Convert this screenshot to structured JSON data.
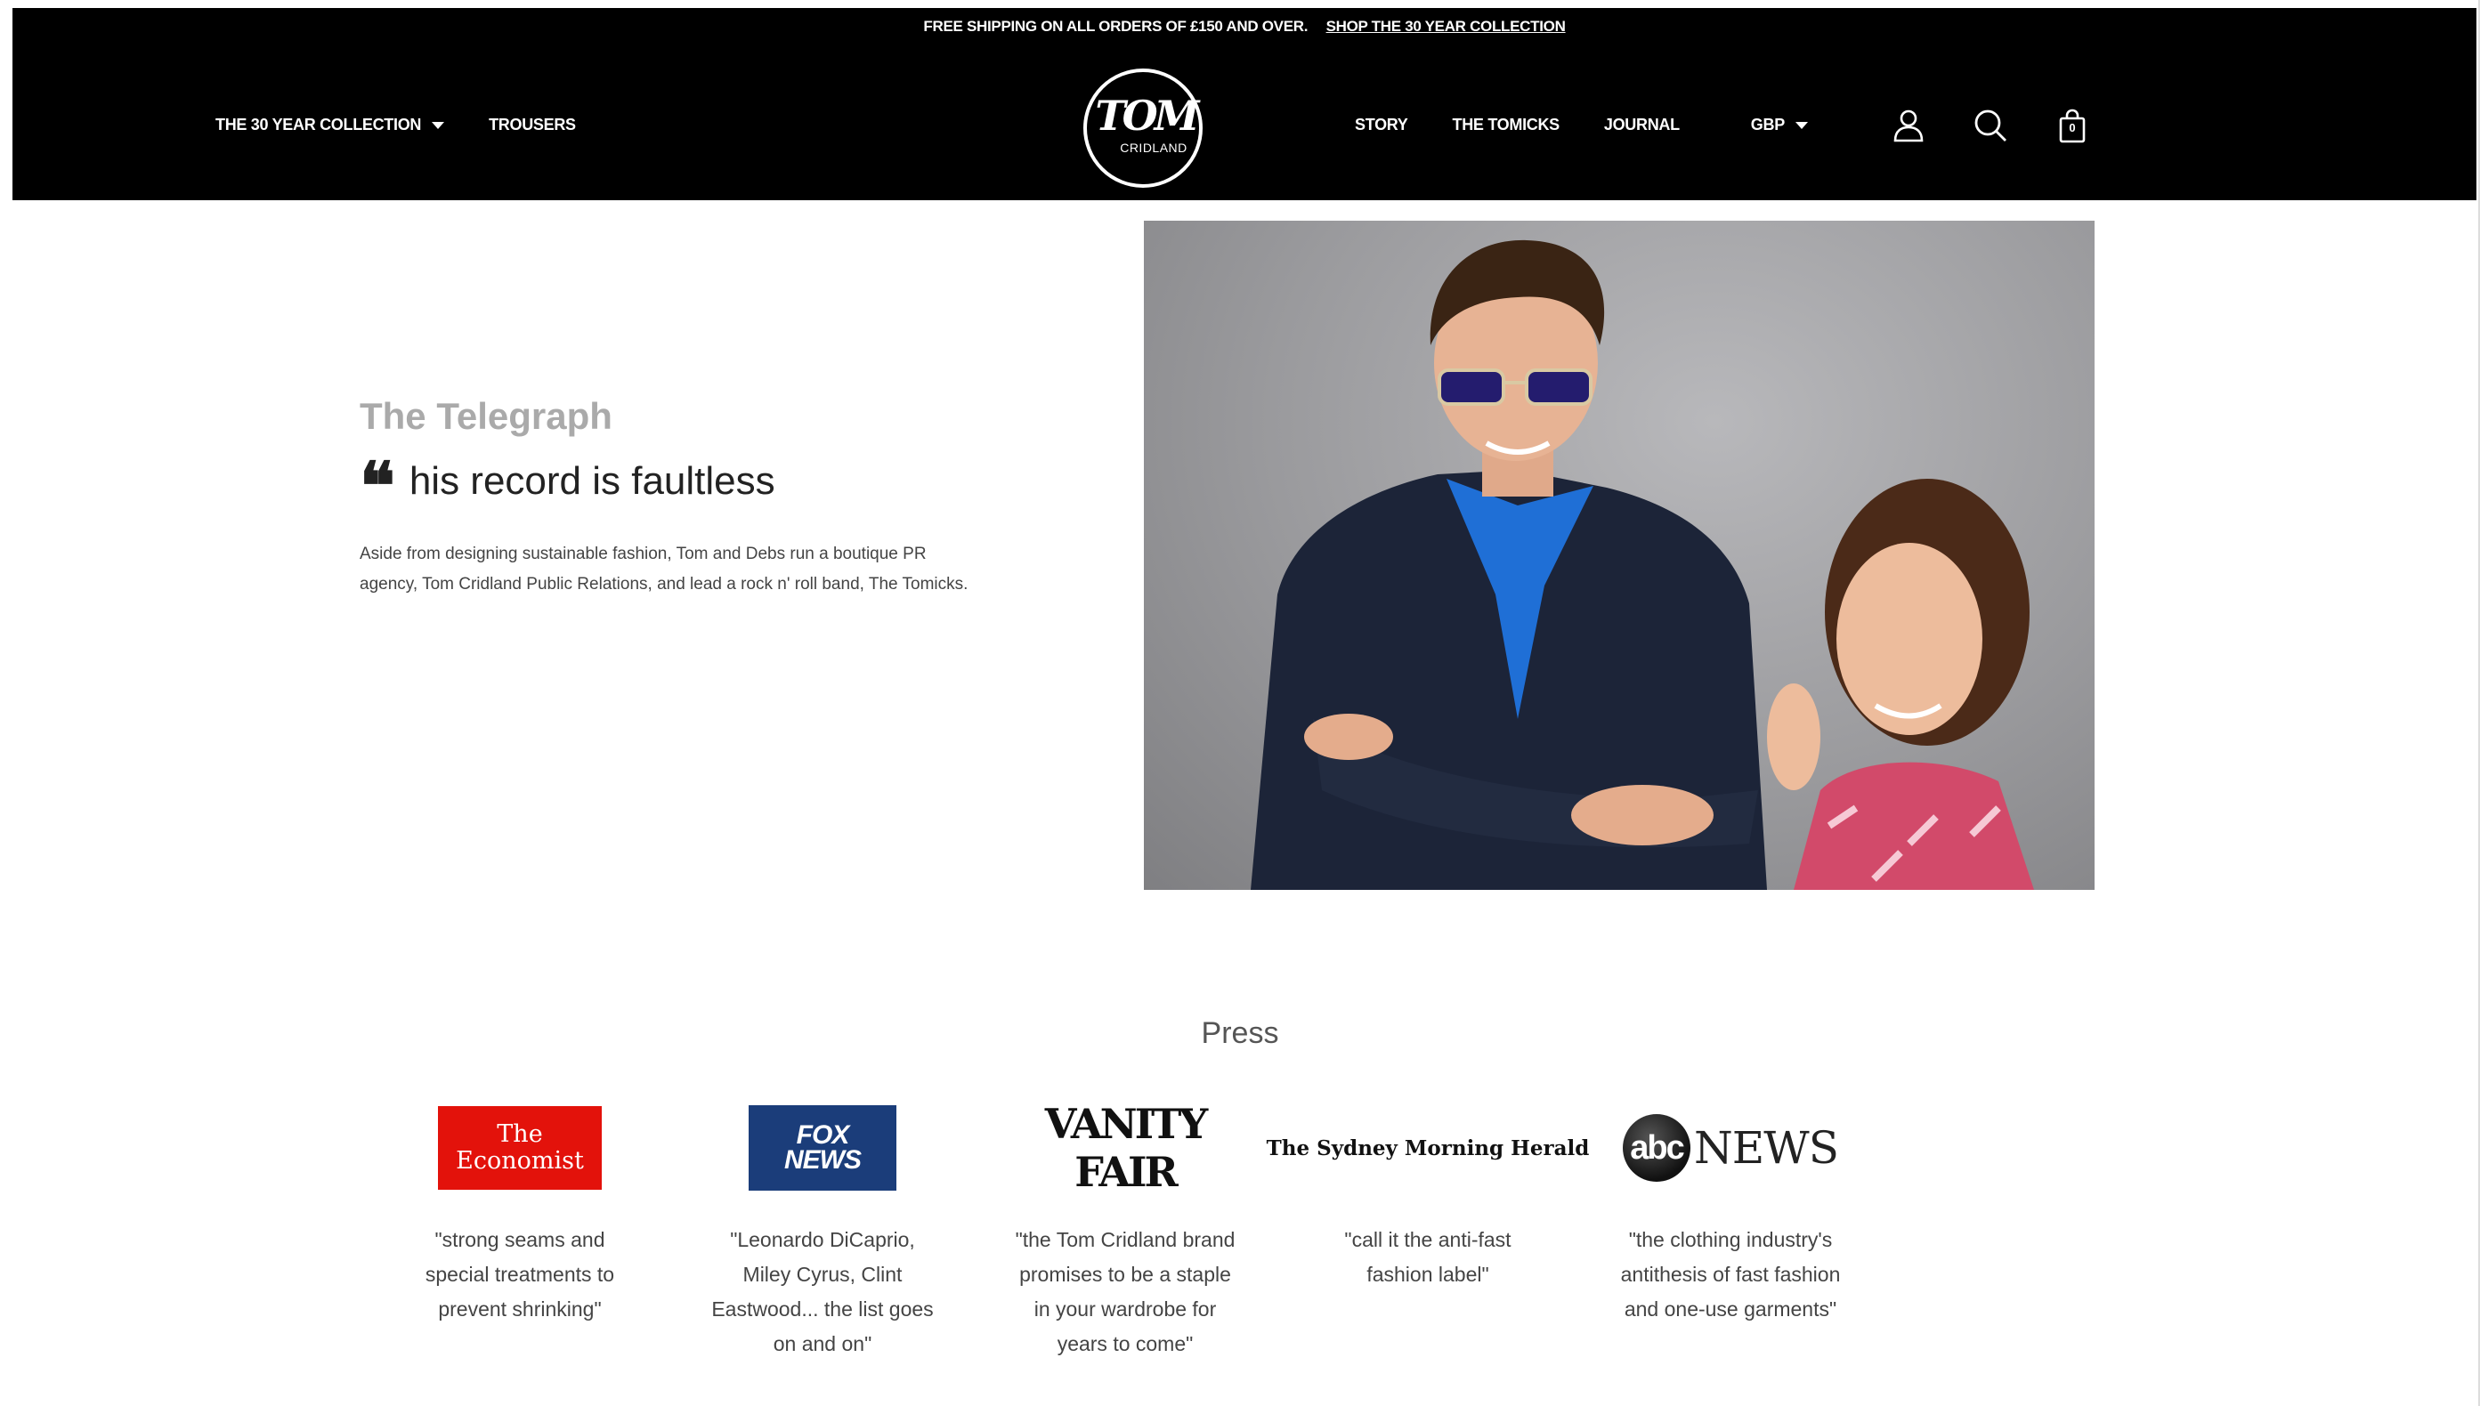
{
  "announcement": {
    "text": "FREE SHIPPING ON ALL ORDERS OF £150 AND OVER.",
    "link": "SHOP THE 30 YEAR COLLECTION"
  },
  "nav": {
    "left": [
      "THE 30 YEAR COLLECTION",
      "TROUSERS"
    ],
    "right": [
      "STORY",
      "THE TOMICKS",
      "JOURNAL"
    ],
    "currency": "GBP"
  },
  "logo": {
    "main": "TOM",
    "sub": "CRIDLAND"
  },
  "cart": {
    "count": "0"
  },
  "icons": [
    "account-icon",
    "search-icon",
    "cart-icon"
  ],
  "hero": {
    "source": "The Telegraph",
    "quote": "his record is faultless",
    "body": "Aside from designing sustainable fashion, Tom and Debs run a boutique PR agency, Tom Cridland Public Relations, and lead a rock n' roll band, The Tomicks."
  },
  "press": {
    "title": "Press",
    "items": [
      {
        "logo_line1": "The",
        "logo_line2": "Economist",
        "quote": "\"strong seams and special treatments to prevent shrinking\""
      },
      {
        "logo_line1": "FOX",
        "logo_line2": "NEWS",
        "quote": "\"Leonardo DiCaprio, Miley Cyrus, Clint Eastwood... the list goes on and on\""
      },
      {
        "logo_line1": "VANITY FAIR",
        "quote": "\"the Tom Cridland brand promises to be a staple in your wardrobe for years to come\""
      },
      {
        "logo_line1": "The Sydney Morning Herald",
        "quote": "\"call it the anti-fast fashion label\""
      },
      {
        "logo_line1": "abc",
        "logo_line2": "NEWS",
        "quote": "\"the clothing industry's antithesis of fast fashion and one-use garments\""
      }
    ]
  },
  "colors": {
    "header_bg": "#000000",
    "economist_red": "#e3120b",
    "fox_blue": "#1b3d7a"
  }
}
